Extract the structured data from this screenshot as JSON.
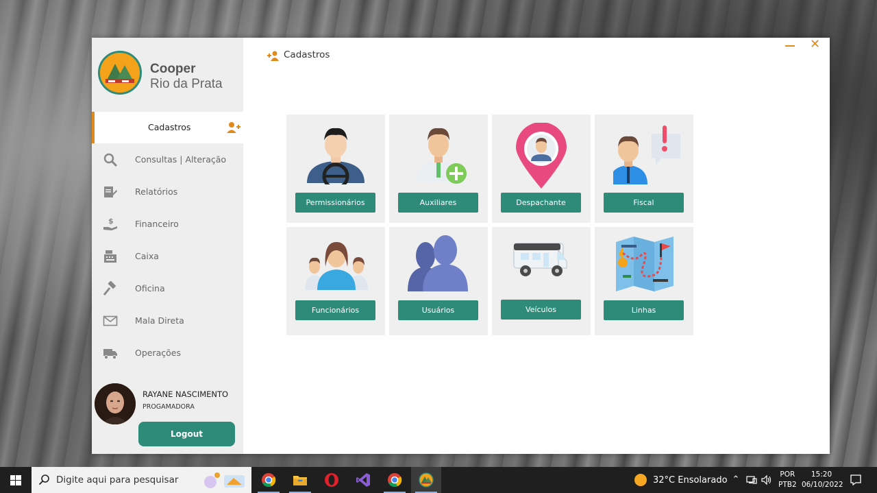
{
  "brand": {
    "name": "Cooper",
    "subtitle": "Rio da Prata"
  },
  "sidebar": {
    "items": [
      {
        "label": "Cadastros",
        "icon": "add-person-icon",
        "active": true
      },
      {
        "label": "Consultas | Alteração",
        "icon": "search-icon"
      },
      {
        "label": "Relatórios",
        "icon": "report-edit-icon"
      },
      {
        "label": "Financeiro",
        "icon": "money-hand-icon"
      },
      {
        "label": "Caixa",
        "icon": "cash-register-icon"
      },
      {
        "label": "Oficina",
        "icon": "hammer-icon"
      },
      {
        "label": "Mala Direta",
        "icon": "envelope-icon"
      },
      {
        "label": "Operações",
        "icon": "truck-icon"
      }
    ]
  },
  "user": {
    "name": "RAYANE NASCIMENTO",
    "role": "PROGAMADORA",
    "logout_label": "Logout"
  },
  "header": {
    "title": "Cadastros",
    "icon": "add-person-icon"
  },
  "tiles": [
    {
      "label": "Permissionários",
      "icon": "driver-icon"
    },
    {
      "label": "Auxiliares",
      "icon": "add-assistant-icon"
    },
    {
      "label": "Despachante",
      "icon": "location-person-icon"
    },
    {
      "label": "Fiscal",
      "icon": "inspector-alert-icon"
    },
    {
      "label": "Funcionários",
      "icon": "employees-group-icon"
    },
    {
      "label": "Usuários",
      "icon": "users-icon"
    },
    {
      "label": "Veículos",
      "icon": "van-icon"
    },
    {
      "label": "Linhas",
      "icon": "route-map-icon"
    }
  ],
  "colors": {
    "accent": "#2e8b7a",
    "highlight": "#e08a1e",
    "sidebar_bg": "#eeeeee",
    "tile_bg": "#efefef"
  },
  "taskbar": {
    "search_placeholder": "Digite aqui para pesquisar",
    "apps": [
      "chrome",
      "file-explorer",
      "opera",
      "visual-studio",
      "chrome",
      "cooper-app"
    ],
    "weather": "32°C  Ensolarado",
    "lang_primary": "POR",
    "lang_secondary": "PTB2",
    "time": "15:20",
    "date": "06/10/2022"
  }
}
